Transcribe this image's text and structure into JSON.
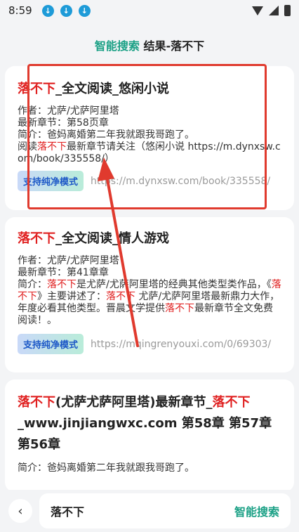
{
  "status_bar": {
    "time": "8:59"
  },
  "header": {
    "prefix": "智能搜索",
    "rest": " 结果-落不下"
  },
  "results": [
    {
      "title_hl": "落不下",
      "title_rest": "_全文阅读_悠闲小说",
      "author": "作者：尤萨/尤萨阿里塔",
      "latest": "最新章节：第58页章",
      "intro": "简介：爸妈离婚第二年我就跟我哥跑了。",
      "desc_a": "阅读",
      "desc_hl": "落不下",
      "desc_b": "最新章节请关注（悠闲小说 https://m.dynxsw.com/book/335558/）",
      "badge": "支持纯净模式",
      "url": "https://m.dynxsw.com/book/335558/"
    },
    {
      "title_hl": "落不下",
      "title_rest": "_全文阅读_情人游戏",
      "author": "作者：尤萨/尤萨阿里塔",
      "latest": "最新章节：第41章章",
      "intro_a": "简介：",
      "intro_hl1": "落不下",
      "intro_b": "是尤萨/尤萨阿里塔的经典其他类型类作品，《",
      "intro_hl2": "落不下",
      "intro_c": "》主要讲述了：",
      "intro_hl3": "落不下",
      "intro_d": " 尤萨/尤萨阿里塔最新鼎力大作，年度必看其他类型。晋晨文学提供",
      "intro_hl4": "落不下",
      "intro_e": "最新章节全文免费阅读！。",
      "badge": "支持纯净模式",
      "url": "https://mqingrenyouxi.com/0/69303/"
    },
    {
      "title_hl1": "落不下",
      "title_mid": "(尤萨尤萨阿里塔)最新章节_",
      "title_hl2": "落不下",
      "title_rest": "_www.jinjiangwxc.com 第58章 第57章 第56章",
      "intro": "简介：爸妈离婚第二年我就跟我哥跑了。"
    }
  ],
  "search": {
    "value": "落不下",
    "button": "智能搜索"
  },
  "colors": {
    "accent": "#1aa085",
    "highlight": "#e02020",
    "annotation": "#e03a2e"
  }
}
